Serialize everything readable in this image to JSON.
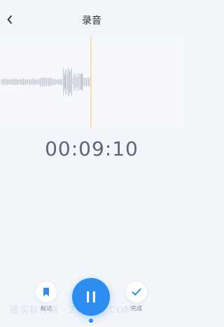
{
  "header": {
    "title": "录音",
    "back_icon": "chevron-left-icon"
  },
  "waveform": {
    "playhead_color": "#f5c26b",
    "wave_color": "#c5ccd6"
  },
  "timer": {
    "elapsed": "00:09:10"
  },
  "controls": {
    "mark_label": "标记",
    "mark_icon": "bookmark-icon",
    "pause_icon": "pause-icon",
    "done_label": "完成",
    "done_icon": "checkmark-icon",
    "accent": "#2d8cf0"
  },
  "watermark": {
    "text": "搜实软件网 · ZHIHUI.COM"
  }
}
